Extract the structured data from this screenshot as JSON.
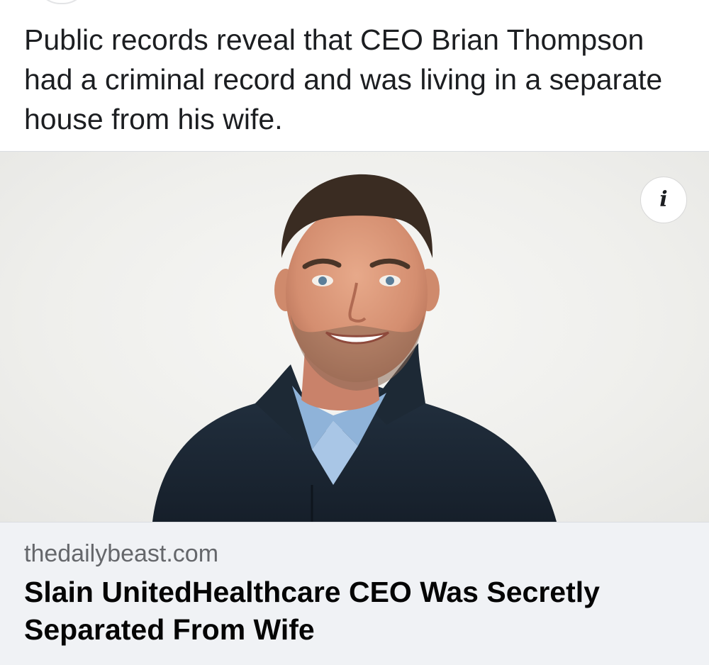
{
  "post": {
    "text": "Public records reveal that CEO Brian Thompson had a criminal record and was living in a separate house from his wife."
  },
  "link_preview": {
    "domain": "thedailybeast.com",
    "headline": "Slain UnitedHealthcare CEO Was Secretly Separated From Wife",
    "info_icon": "info-icon",
    "info_glyph": "i"
  }
}
